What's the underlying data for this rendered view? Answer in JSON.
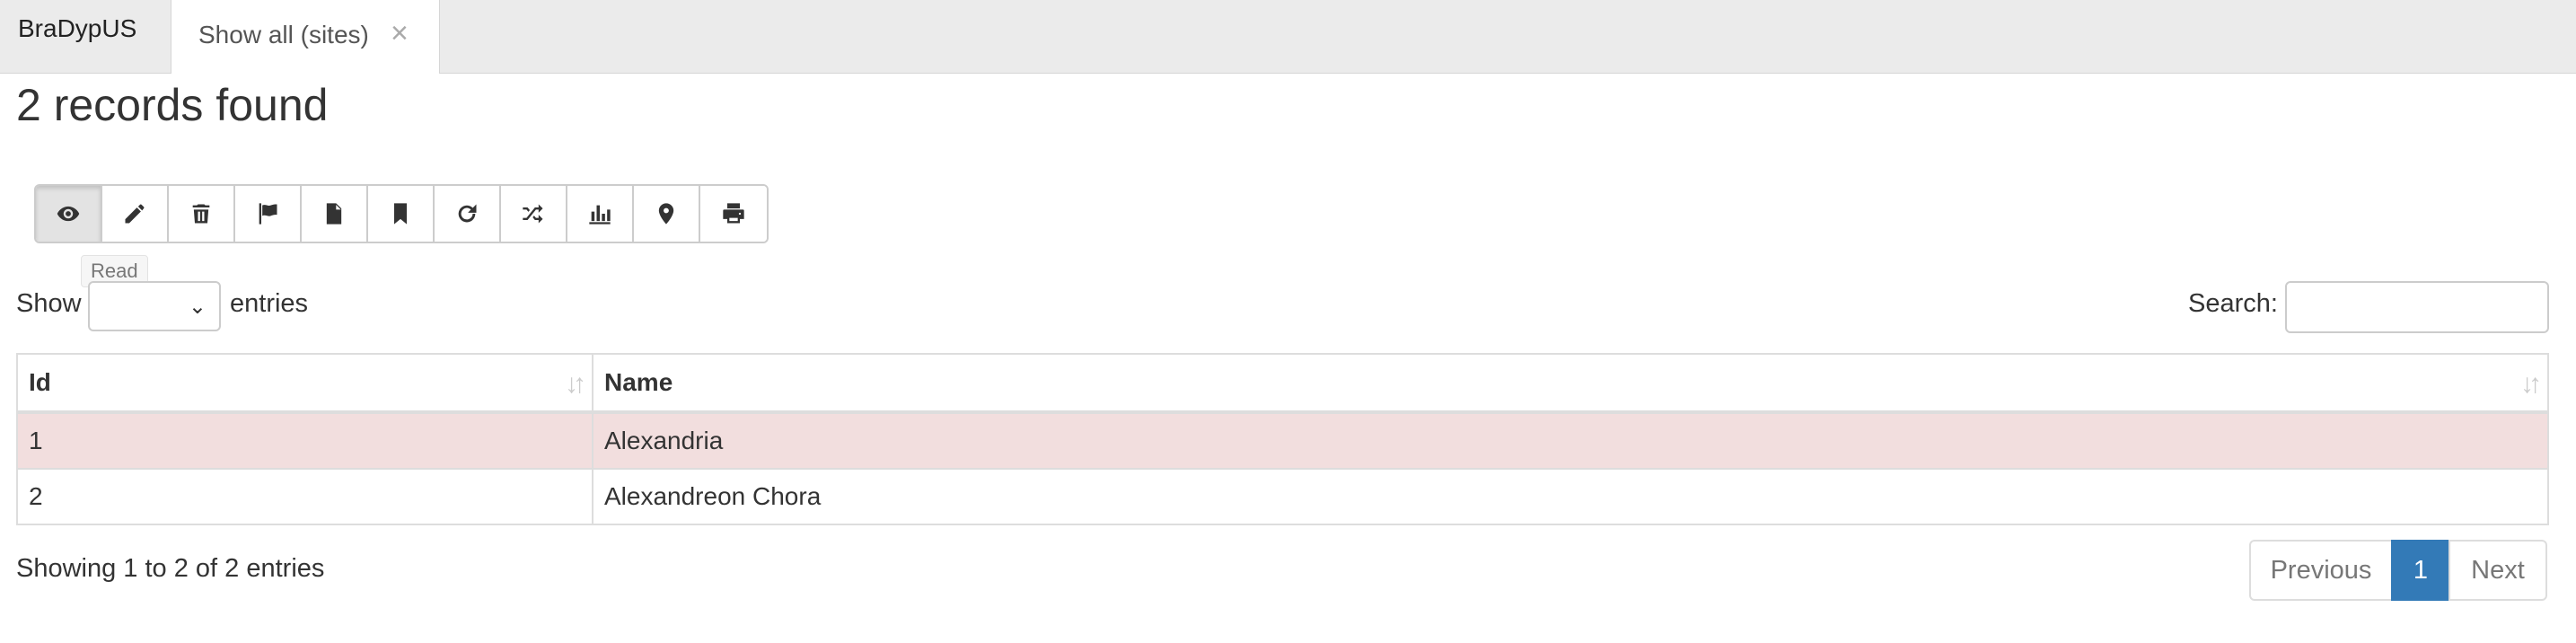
{
  "app": {
    "brand": "BraDypUS"
  },
  "tabs": [
    {
      "label": "Show all (sites)",
      "close": "×"
    }
  ],
  "page": {
    "title": "2 records found"
  },
  "toolbar": {
    "buttons": [
      {
        "icon": "eye-icon",
        "active": true
      },
      {
        "icon": "pencil-icon"
      },
      {
        "icon": "trash-icon"
      },
      {
        "icon": "flag-icon"
      },
      {
        "icon": "file-icon"
      },
      {
        "icon": "bookmark-icon"
      },
      {
        "icon": "refresh-icon"
      },
      {
        "icon": "shuffle-icon"
      },
      {
        "icon": "bar-chart-icon"
      },
      {
        "icon": "map-marker-icon"
      },
      {
        "icon": "print-icon"
      }
    ],
    "tooltip": "Read"
  },
  "length": {
    "show_label": "Show",
    "entries_label": "entries",
    "selected": ""
  },
  "search": {
    "label": "Search:",
    "value": ""
  },
  "table": {
    "columns": [
      "Id",
      "Name"
    ],
    "rows": [
      {
        "id": "1",
        "name": "Alexandria",
        "selected": true
      },
      {
        "id": "2",
        "name": "Alexandreon Chora",
        "selected": false
      }
    ]
  },
  "info": "Showing 1 to 2 of 2 entries",
  "pagination": {
    "previous": "Previous",
    "current": "1",
    "next": "Next"
  },
  "colors": {
    "accent": "#337ab7",
    "selected_row": "#f2dede"
  }
}
